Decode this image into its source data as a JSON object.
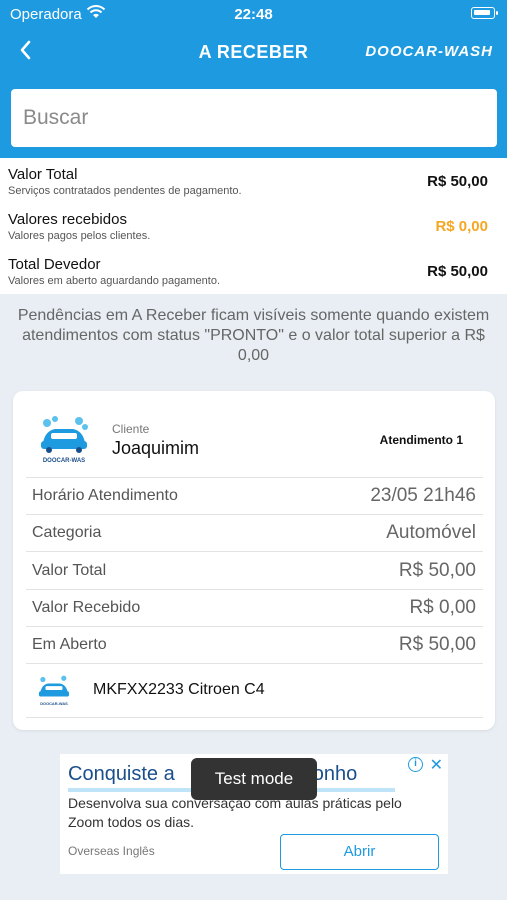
{
  "status_bar": {
    "carrier": "Operadora",
    "time": "22:48"
  },
  "nav": {
    "back_icon": "chevron-left-icon",
    "title": "A RECEBER",
    "brand": "DOOCAR-WASH"
  },
  "search": {
    "placeholder": "Buscar",
    "value": ""
  },
  "summary": [
    {
      "label": "Valor Total",
      "sub": "Serviços contratados pendentes de pagamento.",
      "value": "R$ 50,00",
      "color": "#111111"
    },
    {
      "label": "Valores recebidos",
      "sub": "Valores pagos pelos clientes.",
      "value": "R$ 0,00",
      "color": "#f5a623"
    },
    {
      "label": "Total Devedor",
      "sub": "Valores em aberto aguardando pagamento.",
      "value": "R$ 50,00",
      "color": "#111111"
    }
  ],
  "notice": "Pendências em A Receber ficam visíveis somente quando existem atendimentos com status \"PRONTO\" e o valor total superior a R$ 0,00",
  "card": {
    "client_caption": "Cliente",
    "client_name": "Joaquimim",
    "atendimento": "Atendimento  1",
    "logo_text": "DOOCAR-WAS",
    "rows": [
      {
        "label": "Horário Atendimento",
        "value": "23/05 21h46"
      },
      {
        "label": "Categoria",
        "value": "Automóvel"
      },
      {
        "label": "Valor Total",
        "value": "R$ 50,00"
      },
      {
        "label": "Valor Recebido",
        "value": "R$ 0,00"
      },
      {
        "label": "Em Aberto",
        "value": "R$ 50,00"
      }
    ],
    "vehicle": "MKFXX2233 Citroen C4"
  },
  "ad": {
    "headline": "Conquiste a",
    "headline_end": "sonho",
    "description": "Desenvolva sua conversação com aulas práticas pelo Zoom todos os dias.",
    "advertiser": "Overseas Inglês",
    "cta": "Abrir"
  },
  "toast": "Test mode",
  "colors": {
    "primary": "#1e9ae0",
    "accent_orange": "#f5a623",
    "background": "#e8eef3"
  }
}
